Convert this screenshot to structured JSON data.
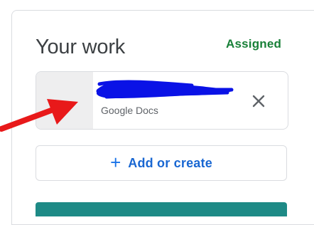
{
  "panel": {
    "title": "Your work",
    "status": "Assigned"
  },
  "attachment": {
    "name": "",
    "type_label": "Google Docs",
    "remove_icon": "close-icon"
  },
  "actions": {
    "add_label": "Add or create",
    "add_icon": "plus-icon"
  },
  "colors": {
    "status": "#188038",
    "accent": "#1a73e8",
    "primary_button": "#1e8a86",
    "annotation_arrow": "#e8191a",
    "redaction": "#0a12e6"
  }
}
